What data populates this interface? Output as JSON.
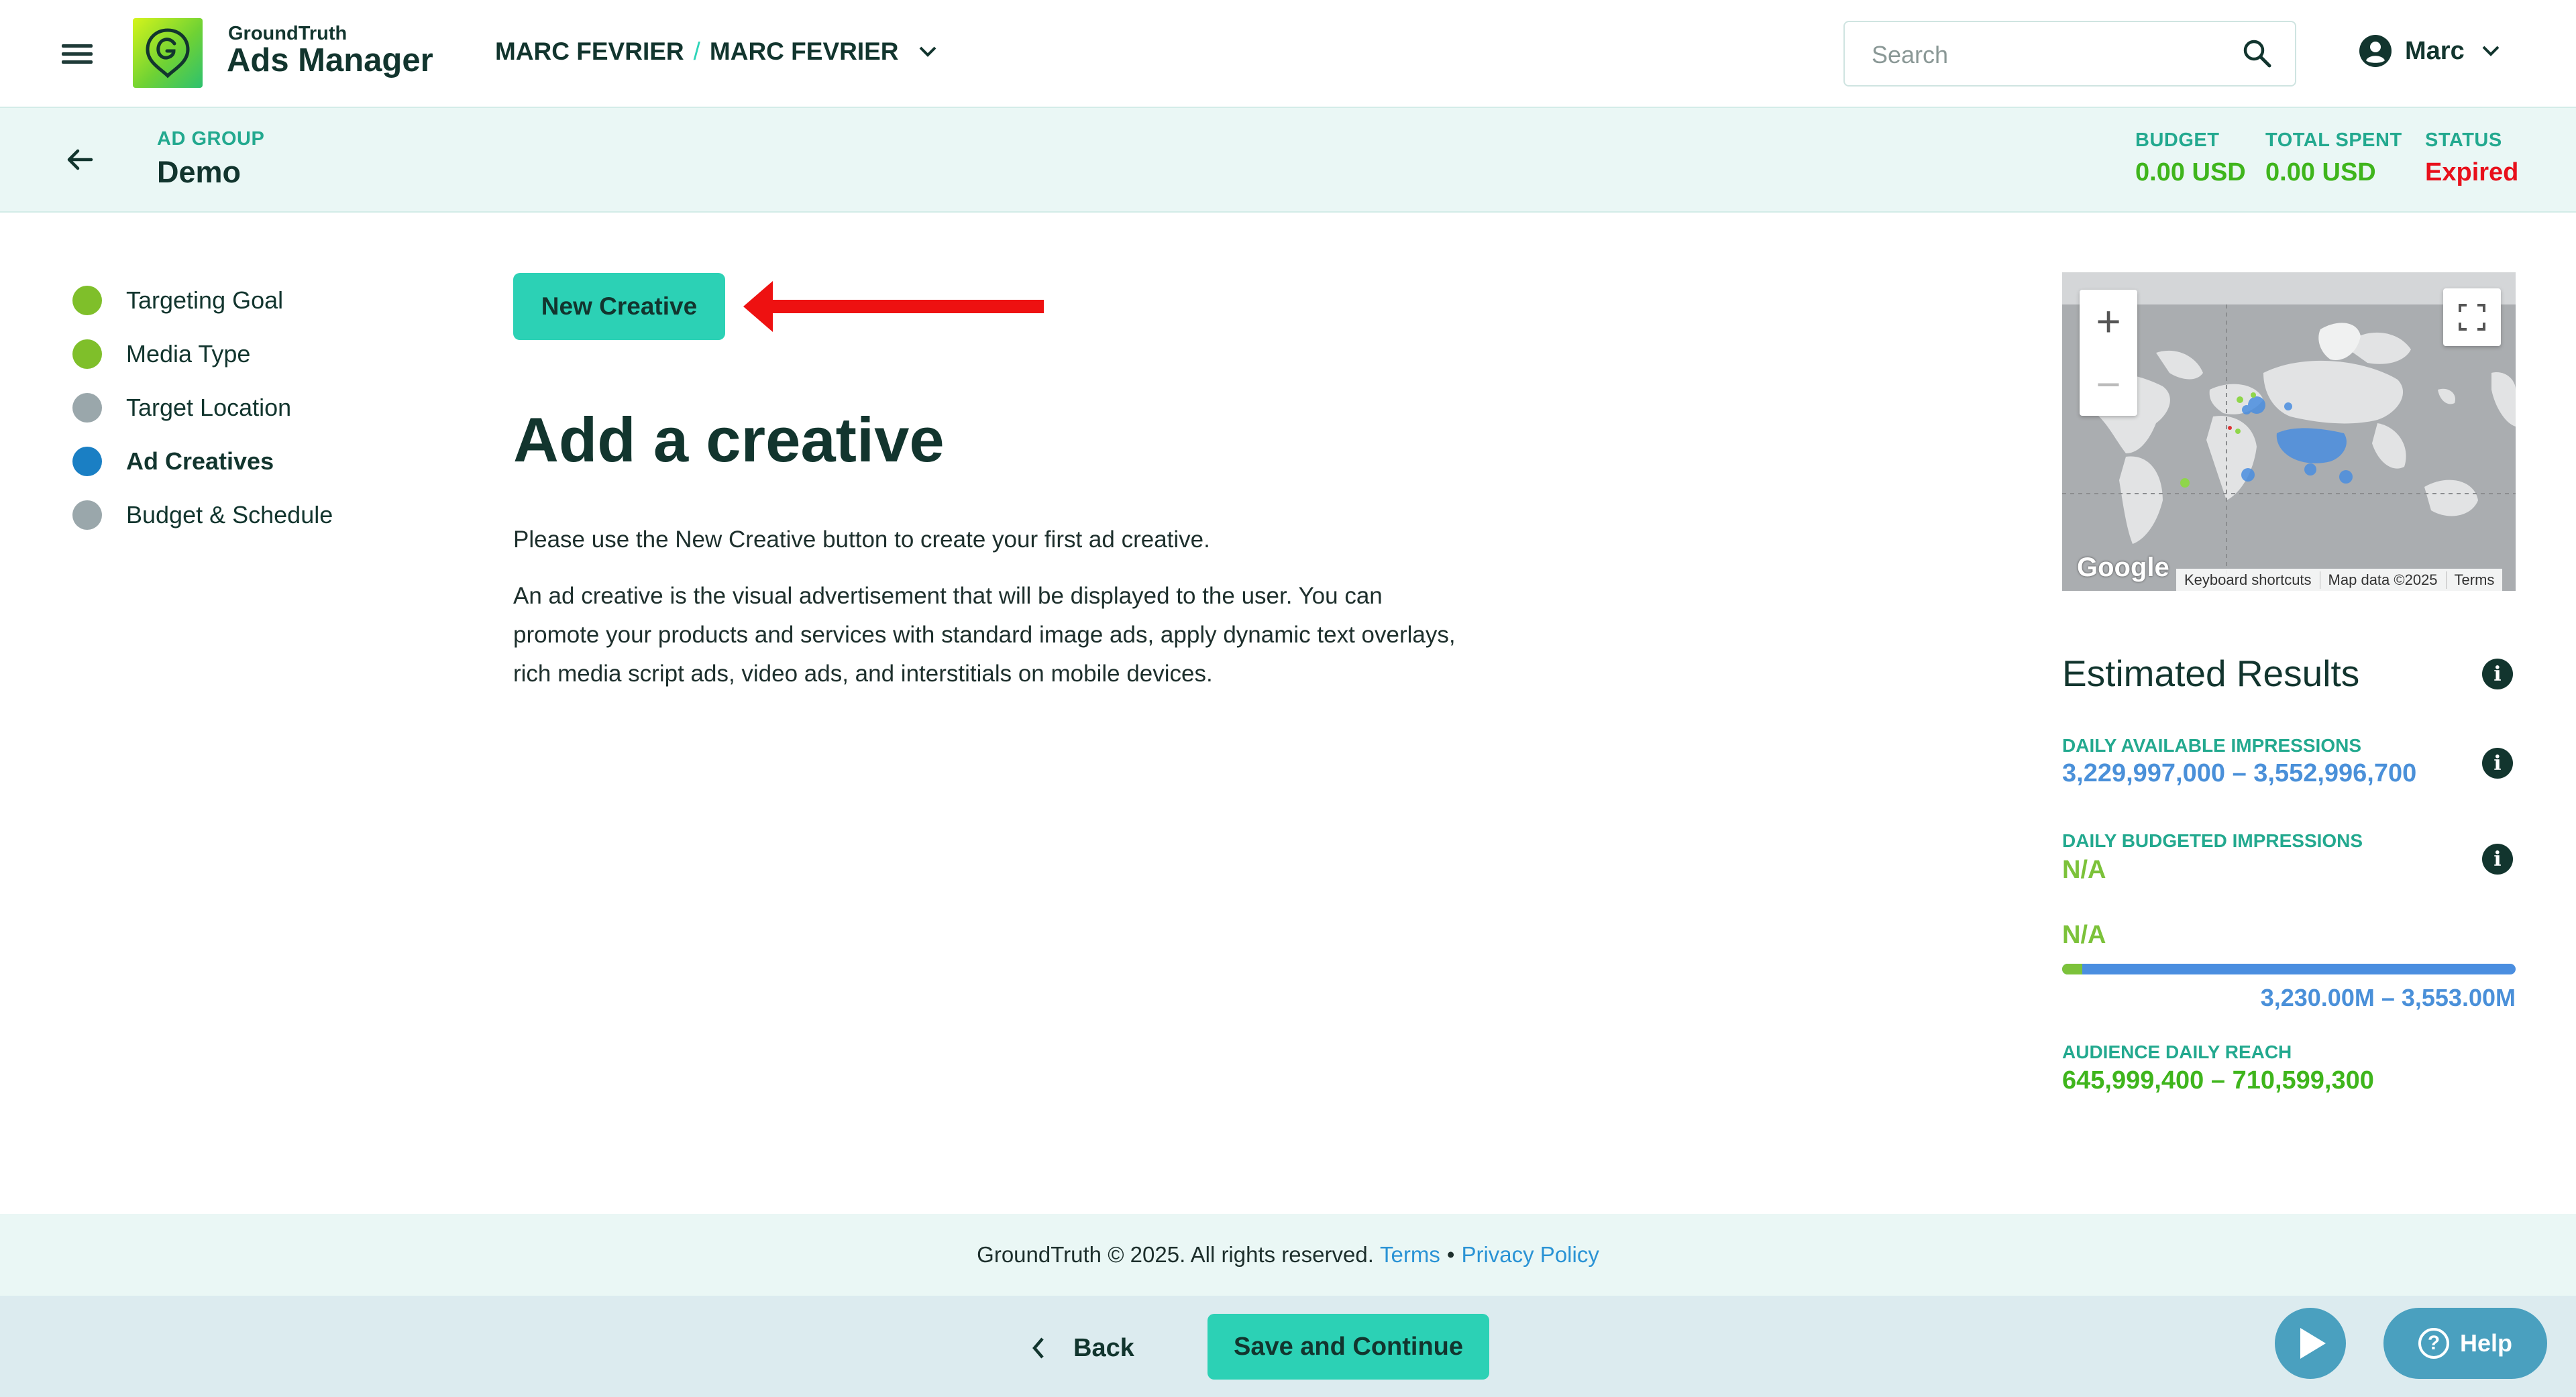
{
  "header": {
    "brand_small": "GroundTruth",
    "brand_big": "Ads Manager",
    "account_left": "MARC FEVRIER",
    "account_separator": "/",
    "account_right": "MARC FEVRIER",
    "search_placeholder": "Search",
    "user_name": "Marc"
  },
  "ad_group": {
    "label": "AD GROUP",
    "name": "Demo",
    "budget_label": "BUDGET",
    "budget_value": "0.00 USD",
    "spent_label": "TOTAL SPENT",
    "spent_value": "0.00 USD",
    "status_label": "STATUS",
    "status_value": "Expired"
  },
  "steps": [
    {
      "label": "Targeting Goal",
      "state": "complete"
    },
    {
      "label": "Media Type",
      "state": "complete"
    },
    {
      "label": "Target Location",
      "state": "incomplete"
    },
    {
      "label": "Ad Creatives",
      "state": "current"
    },
    {
      "label": "Budget & Schedule",
      "state": "incomplete"
    }
  ],
  "main": {
    "new_creative_label": "New Creative",
    "title": "Add a creative",
    "intro": "Please use the New Creative button to create your first ad creative.",
    "description": "An ad creative is the visual advertisement that will be displayed to the user. You can promote your products and services with standard image ads, apply dynamic text overlays, rich media script ads, video ads, and interstitials on mobile devices."
  },
  "map": {
    "google_label": "Google",
    "keyboard_shortcuts": "Keyboard shortcuts",
    "map_data": "Map data ©2025",
    "terms": "Terms"
  },
  "estimates": {
    "title": "Estimated Results",
    "daily_available_label": "DAILY AVAILABLE IMPRESSIONS",
    "daily_available_value": "3,229,997,000 – 3,552,996,700",
    "daily_budgeted_label": "DAILY BUDGETED IMPRESSIONS",
    "daily_budgeted_value": "N/A",
    "reach_na": "N/A",
    "reach_range": "3,230.00M – 3,553.00M",
    "reach_budget_fraction": 0.045,
    "audience_label": "AUDIENCE DAILY REACH",
    "audience_value": "645,999,400 – 710,599,300"
  },
  "footer": {
    "copyright": "GroundTruth © 2025. All rights reserved.",
    "terms": "Terms",
    "bullet": "•",
    "privacy": "Privacy Policy"
  },
  "actions": {
    "back_label": "Back",
    "save_label": "Save and Continue",
    "help_label": "Help"
  },
  "colors": {
    "accent": "#2cd1b5",
    "step_complete": "#7fbf2a",
    "step_incomplete": "#9aa7ab",
    "step_current": "#1a7fc4",
    "status_expired": "#e8101b"
  }
}
